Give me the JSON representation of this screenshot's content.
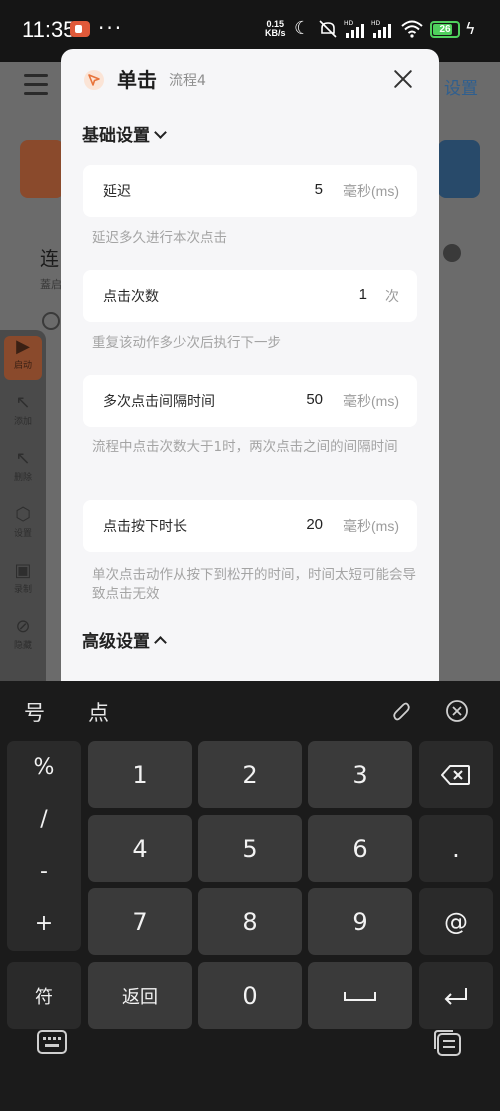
{
  "status_bar": {
    "time": "11:35",
    "dots": "···",
    "net_speed_value": "0.15",
    "net_speed_unit": "KB/s",
    "battery": "26"
  },
  "background_app": {
    "settings_label": "设置",
    "item_title": "连",
    "item_sub": "蓋启"
  },
  "toolbar": {
    "start": "启动",
    "add": "添加",
    "remove": "删除",
    "settings": "设置",
    "record": "录制",
    "hide": "隐藏"
  },
  "modal": {
    "title": "单击",
    "subtitle": "流程4",
    "basic_section": "基础设置",
    "advanced_section": "高级设置",
    "settings": [
      {
        "label": "延迟",
        "value": "5",
        "unit": "毫秒(ms)",
        "description": "延迟多久进行本次点击"
      },
      {
        "label": "点击次数",
        "value": "1",
        "unit": "次",
        "description": "重复该动作多少次后执行下一步"
      },
      {
        "label": "多次点击间隔时间",
        "value": "50",
        "unit": "毫秒(ms)",
        "description": "流程中点击次数大于1时，两次点击之间的间隔时间"
      },
      {
        "label": "点击按下时长",
        "value": "20",
        "unit": "毫秒(ms)",
        "description": "单次点击动作从按下到松开的时间，时间太短可能会导致点击无效"
      }
    ]
  },
  "keyboard": {
    "suggestions": [
      "号",
      "点"
    ],
    "side_keys": [
      "%",
      "/",
      "-",
      "+"
    ],
    "digits": [
      "1",
      "2",
      "3",
      "4",
      "5",
      "6",
      "7",
      "8",
      "9"
    ],
    "dot": ".",
    "at": "@",
    "symbols": "符",
    "back": "返回",
    "zero": "0",
    "space": "␣"
  },
  "colors": {
    "modal_bg": "#f6f6f8",
    "keyboard_bg": "#1b1b1b",
    "key_bg": "#3a3a3a",
    "accent_orange": "#e8743b"
  }
}
